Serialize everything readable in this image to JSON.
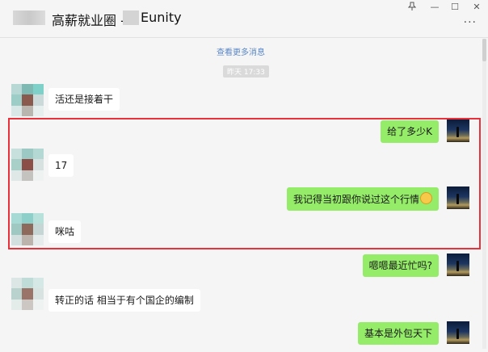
{
  "window": {
    "title": "高薪就业圈 - ",
    "title_suffix": "Eunity",
    "controls": {
      "pin_icon": "pin-icon",
      "minimize": "—",
      "maximize": "☐",
      "close": "✕",
      "more": "···"
    }
  },
  "chat": {
    "load_more": "查看更多消息",
    "timestamp": "昨天 17:33",
    "messages": [
      {
        "side": "in",
        "text": "活还是接着干"
      },
      {
        "side": "out",
        "text": "给了多少K"
      },
      {
        "side": "in",
        "text": "17"
      },
      {
        "side": "out",
        "text": "我记得当初跟你说过这个行情",
        "emoji": "laughing-emoji"
      },
      {
        "side": "in",
        "text": "咪咕"
      },
      {
        "side": "out",
        "text": "嗯嗯最近忙吗?"
      },
      {
        "side": "in",
        "text": "转正的话 相当于有个国企的编制"
      },
      {
        "side": "out",
        "text": "基本是外包天下"
      }
    ]
  },
  "colors": {
    "background": "#f5f5f5",
    "outgoing_bubble": "#95ec69",
    "incoming_bubble": "#ffffff",
    "highlight_border": "#e8313a",
    "link": "#5b88c6"
  }
}
